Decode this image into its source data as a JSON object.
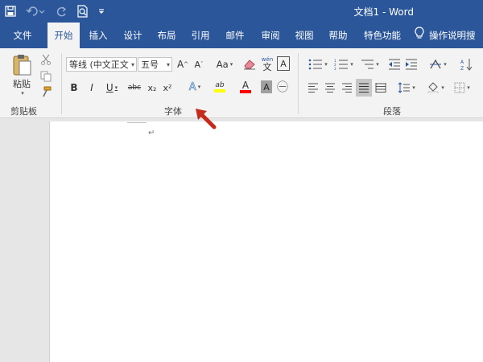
{
  "window": {
    "title": "文档1 - Word"
  },
  "qat": {
    "icons": [
      "save-icon",
      "undo-icon",
      "redo-icon",
      "print-preview-icon",
      "customize-qat-icon"
    ]
  },
  "tabs": [
    {
      "label": "文件"
    },
    {
      "label": "开始"
    },
    {
      "label": "插入"
    },
    {
      "label": "设计"
    },
    {
      "label": "布局"
    },
    {
      "label": "引用"
    },
    {
      "label": "邮件"
    },
    {
      "label": "审阅"
    },
    {
      "label": "视图"
    },
    {
      "label": "帮助"
    },
    {
      "label": "特色功能"
    },
    {
      "label": "操作说明搜"
    }
  ],
  "clipboard": {
    "paste_label": "粘贴",
    "group_label": "剪贴板"
  },
  "font": {
    "group_label": "字体",
    "font_name": "等线 (中文正文",
    "font_size": "五号",
    "bold": "B",
    "italic": "I",
    "underline": "U",
    "strike": "abc",
    "subscript": "x₂",
    "superscript": "x²",
    "grow": "A",
    "shrink": "A",
    "case": "Aa",
    "text_effect": "A",
    "highlight": "ab",
    "font_color": "A",
    "char_shading": "A",
    "enclose": "㊀",
    "pinyin": "文",
    "border": "A",
    "highlight_color": "#ffff00",
    "font_color_value": "#ff0000"
  },
  "paragraph": {
    "group_label": "段落"
  },
  "document": {
    "para_mark": "↵"
  },
  "annotation": {
    "arrow_color": "#c42b1c"
  },
  "colors": {
    "brand": "#2b579a",
    "ribbon_bg": "#f3f3f3"
  }
}
